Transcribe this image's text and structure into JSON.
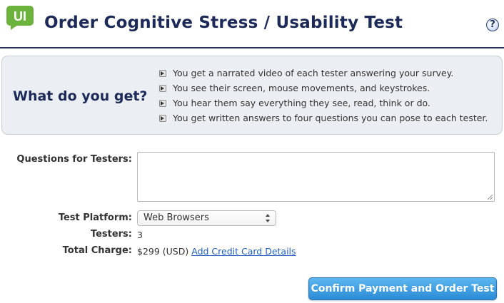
{
  "header": {
    "logo_text": "UI",
    "title": "Order Cognitive Stress / Usability Test",
    "help_label": "?"
  },
  "panel": {
    "heading": "What do you get?",
    "benefits": [
      "You get a narrated video of each tester answering your survey.",
      "You see their screen, mouse movements, and keystrokes.",
      "You hear them say everything they see, read, think or do.",
      "You get written answers to four questions you can pose to each tester."
    ]
  },
  "form": {
    "questions_label": "Questions for Testers:",
    "questions_value": "",
    "platform_label": "Test Platform:",
    "platform_value": "Web Browsers",
    "testers_label": "Testers:",
    "testers_value": "3",
    "charge_label": "Total Charge:",
    "charge_value": "$299 (USD)",
    "credit_link": "Add Credit Card Details"
  },
  "actions": {
    "confirm_label": "Confirm Payment and Order Test"
  },
  "colors": {
    "title": "#1c2a5a",
    "logo_green": "#6cb33e",
    "button_blue": "#2b8bd6",
    "link": "#1f5fbf"
  }
}
